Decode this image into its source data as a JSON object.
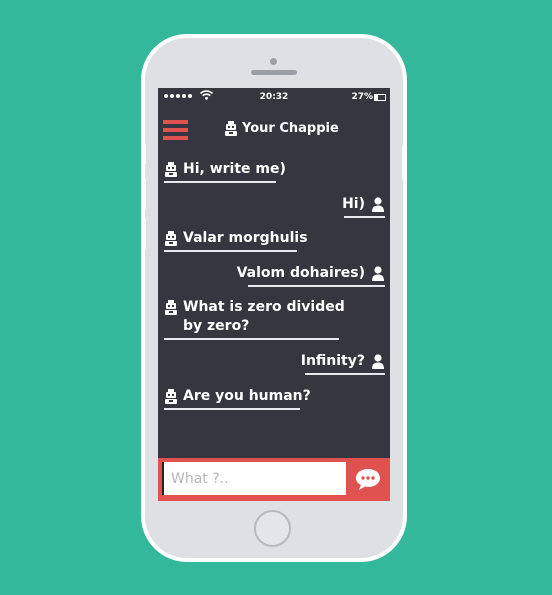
{
  "status_bar": {
    "time": "20:32",
    "battery": "27%"
  },
  "header": {
    "title": "Your Chappie",
    "menu_icon": "hamburger-menu-icon",
    "title_icon": "robot-icon"
  },
  "messages": [
    {
      "from": "bot",
      "text": "Hi, write me)"
    },
    {
      "from": "user",
      "text": "Hi)"
    },
    {
      "from": "bot",
      "text": "Valar morghulis"
    },
    {
      "from": "user",
      "text": "Valom dohaires)"
    },
    {
      "from": "bot",
      "text": "What is zero divided\nby zero?"
    },
    {
      "from": "user",
      "text": "Infinity?"
    },
    {
      "from": "bot",
      "text": "Are you human?"
    }
  ],
  "composer": {
    "placeholder": "What ?..",
    "value": "",
    "send_icon": "chat-bubble-send-icon"
  },
  "colors": {
    "background": "#33b89c",
    "screen": "#35363f",
    "accent": "#e0524f",
    "phone_body": "#dfe0e4"
  }
}
